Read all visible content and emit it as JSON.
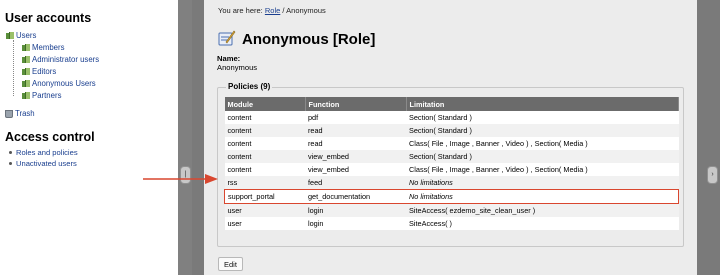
{
  "sidebar": {
    "user_accounts_heading": "User accounts",
    "tree": {
      "root": "Users",
      "children": [
        "Members",
        "Administrator users",
        "Editors",
        "Anonymous Users",
        "Partners"
      ],
      "trash": "Trash"
    },
    "access_control_heading": "Access control",
    "access_links": [
      "Roles and policies",
      "Unactivated users"
    ]
  },
  "breadcrumb": {
    "prefix": "You are here:",
    "link": "Role",
    "separator": "/",
    "current": "Anonymous"
  },
  "page": {
    "title": "Anonymous [Role]",
    "name_label": "Name:",
    "name_value": "Anonymous"
  },
  "policies": {
    "legend": "Policies (9)",
    "columns": [
      "Module",
      "Function",
      "Limitation"
    ],
    "rows": [
      {
        "module": "content",
        "function": "pdf",
        "limitation": "Section( Standard )"
      },
      {
        "module": "content",
        "function": "read",
        "limitation": "Section( Standard )"
      },
      {
        "module": "content",
        "function": "read",
        "limitation": "Class( File , Image , Banner , Video ) , Section( Media )"
      },
      {
        "module": "content",
        "function": "view_embed",
        "limitation": "Section( Standard )"
      },
      {
        "module": "content",
        "function": "view_embed",
        "limitation": "Class( File , Image , Banner , Video ) , Section( Media )"
      },
      {
        "module": "rss",
        "function": "feed",
        "limitation": "No limitations"
      },
      {
        "module": "support_portal",
        "function": "get_documentation",
        "limitation": "No limitations"
      },
      {
        "module": "user",
        "function": "login",
        "limitation": "SiteAccess( ezdemo_site_clean_user )"
      },
      {
        "module": "user",
        "function": "login",
        "limitation": "SiteAccess( )"
      }
    ]
  },
  "buttons": {
    "edit": "Edit"
  },
  "colors": {
    "highlight": "#d9472f",
    "header_bg": "#6b6b6b",
    "link": "#1a3f8f"
  }
}
